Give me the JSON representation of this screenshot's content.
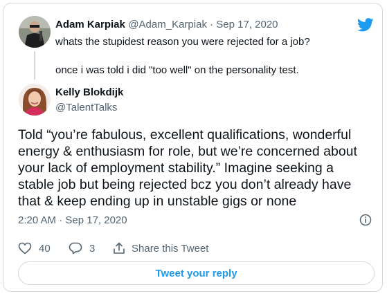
{
  "quoted": {
    "name": "Adam Karpiak",
    "handle_date": "@Adam_Karpiak · Sep 17, 2020",
    "text_line1": "whats the stupidest reason you were rejected for a job?",
    "text_line2": "once i was told i did \"too well\" on the personality test."
  },
  "reply": {
    "name": "Kelly Blokdijk",
    "handle": "@TalentTalks",
    "text": "Told “you’re fabulous, excellent qualifications, wonderful\nenergy & enthusiasm for role, but we’re concerned about\nyour lack of employment stability.” Imagine seeking a\nstable job but being rejected bcz you don’t already have\nthat & keep ending up in unstable gigs or none",
    "timestamp": "2:20 AM · Sep 17, 2020"
  },
  "actions": {
    "likes": "40",
    "replies": "3",
    "share_label": "Share this Tweet"
  },
  "reply_button_label": "Tweet your reply",
  "colors": {
    "twitter_blue": "#1d9bf0",
    "secondary_text": "#536471",
    "border": "#cfd9de"
  },
  "icons": [
    "twitter-bird-icon",
    "info-icon",
    "heart-icon",
    "reply-bubble-icon",
    "share-icon"
  ]
}
